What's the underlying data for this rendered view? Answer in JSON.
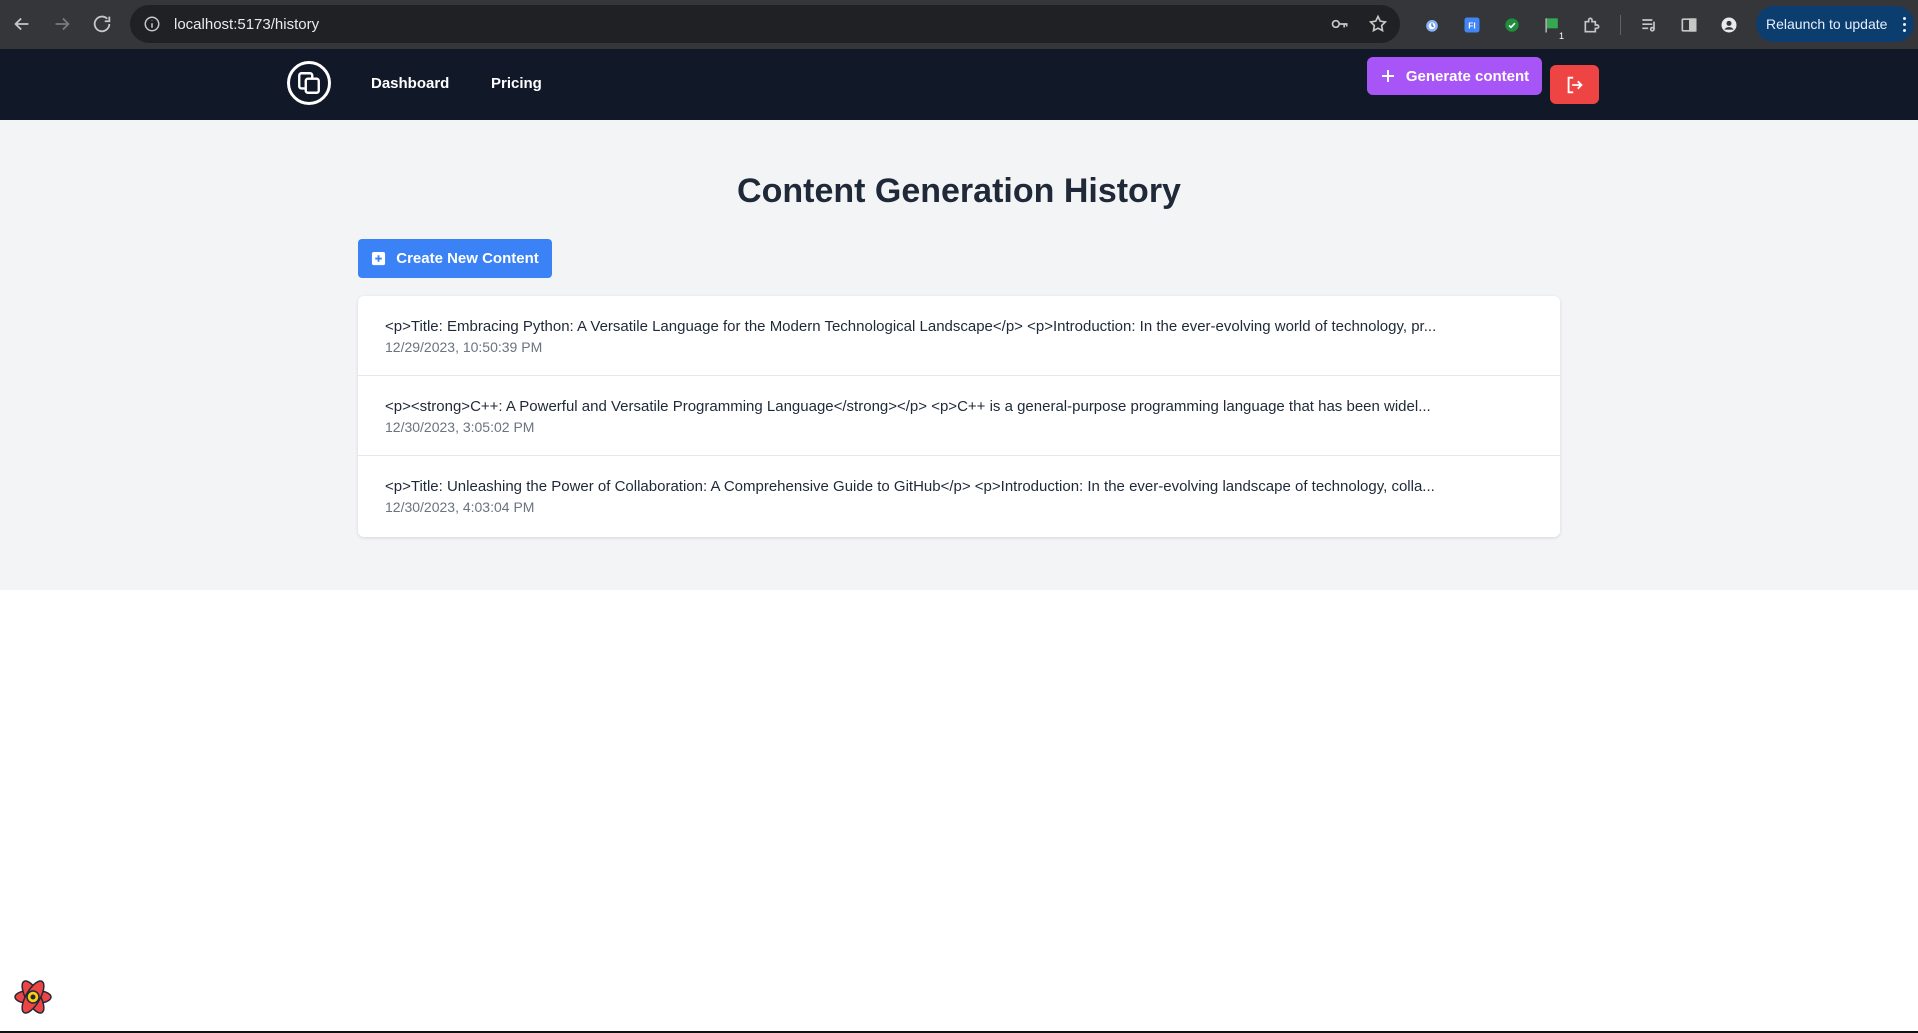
{
  "browser": {
    "url": "localhost:5173/history",
    "relaunch_label": "Relaunch to update",
    "extension_badge": "1"
  },
  "header": {
    "nav": [
      {
        "label": "Dashboard"
      },
      {
        "label": "Pricing"
      }
    ],
    "generate_label": "Generate content"
  },
  "page": {
    "title": "Content Generation History",
    "create_label": "Create New Content"
  },
  "history": [
    {
      "content": "<p>Title: Embracing Python: A Versatile Language for the Modern Technological Landscape</p> <p>Introduction: In the ever-evolving world of technology, pr...",
      "date": "12/29/2023, 10:50:39 PM"
    },
    {
      "content": "<p><strong>C++: A Powerful and Versatile Programming Language</strong></p> <p>C++ is a general-purpose programming language that has been widel...",
      "date": "12/30/2023, 3:05:02 PM"
    },
    {
      "content": "<p>Title: Unleashing the Power of Collaboration: A Comprehensive Guide to GitHub</p> <p>Introduction: In the ever-evolving landscape of technology, colla...",
      "date": "12/30/2023, 4:03:04 PM"
    }
  ],
  "colors": {
    "header_bg": "#111827",
    "generate_btn": "#a855f7",
    "logout_btn": "#ef4444",
    "create_btn": "#3b82f6",
    "main_bg": "#f3f4f6"
  }
}
